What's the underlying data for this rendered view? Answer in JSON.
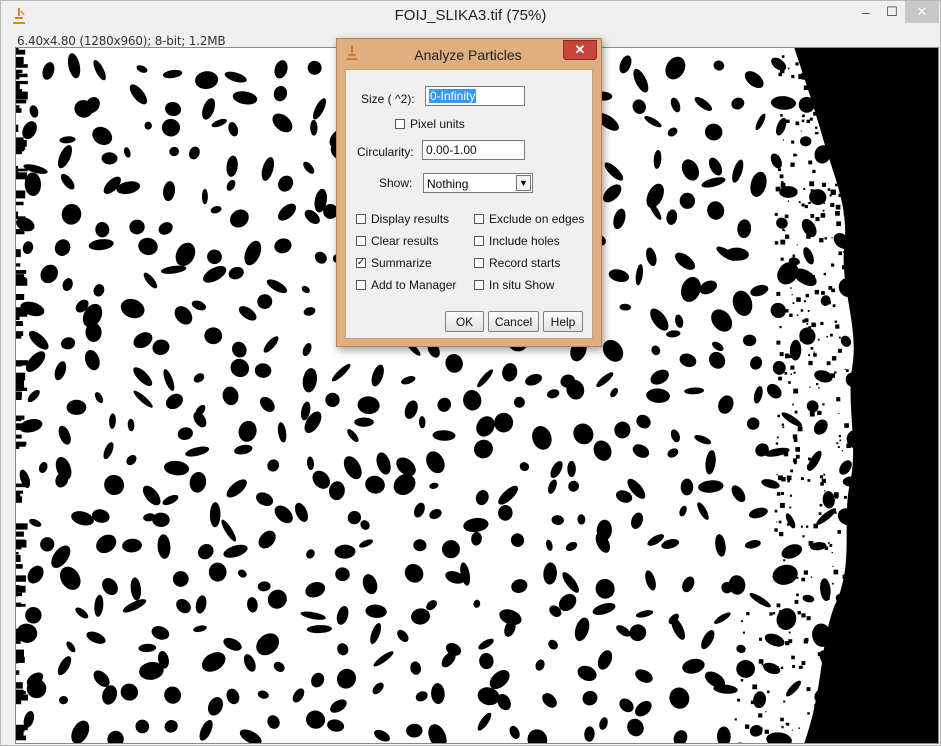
{
  "window": {
    "title": "FOIJ_SLIKA3.tif (75%)",
    "info": "6.40x4.80  (1280x960); 8-bit; 1.2MB",
    "icons": {
      "app": "imagej-microscope-icon",
      "minimize": "minimize-icon",
      "maximize": "maximize-icon",
      "close": "close-icon"
    }
  },
  "dialog": {
    "title": "Analyze Particles",
    "size_label": "Size ( ^2):",
    "size_value": "0-Infinity",
    "pixel_units": "Pixel units",
    "circularity_label": "Circularity:",
    "circularity_value": "0.00-1.00",
    "show_label": "Show:",
    "show_value": "Nothing",
    "checkboxes": {
      "display_results": "Display results",
      "clear_results": "Clear results",
      "summarize": "Summarize",
      "add_to_manager": "Add to Manager",
      "exclude_on_edges": "Exclude on edges",
      "include_holes": "Include holes",
      "record_starts": "Record starts",
      "in_situ_show": "In situ Show"
    },
    "checked_mark": "✓",
    "ok": "OK",
    "cancel": "Cancel",
    "help": "Help"
  }
}
